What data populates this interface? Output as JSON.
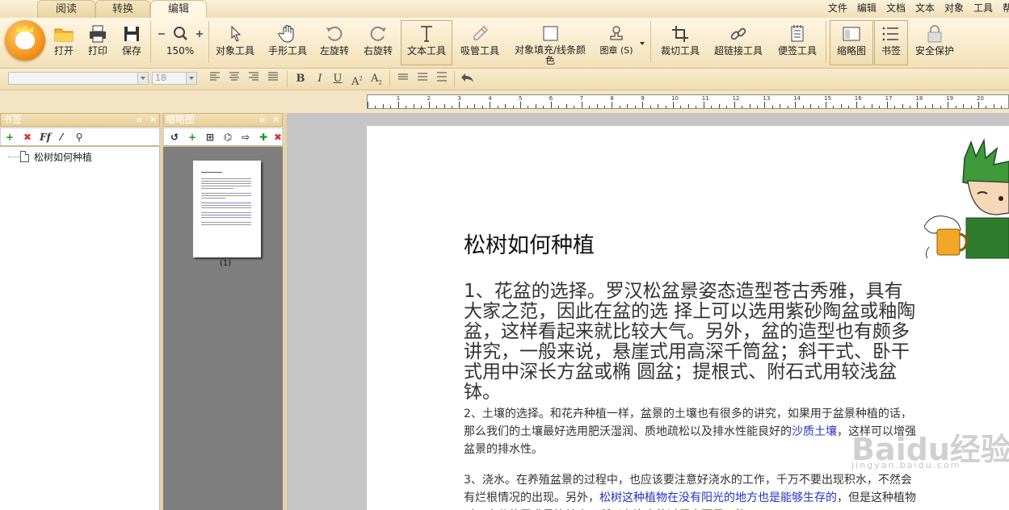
{
  "tabs": [
    {
      "label": "阅读"
    },
    {
      "label": "转换"
    },
    {
      "label": "编辑"
    }
  ],
  "menu": [
    "文件",
    "编辑",
    "文档",
    "文本",
    "对象",
    "工具",
    "帮"
  ],
  "toolbar": {
    "open": "打开",
    "print": "打印",
    "save": "保存",
    "zoom": "150%",
    "object_tool": "对象工具",
    "hand_tool": "手形工具",
    "rotate_left": "左旋转",
    "rotate_right": "右旋转",
    "text_tool": "文本工具",
    "eyedropper": "吸管工具",
    "fill_line": "对象填充/线条颜色",
    "stamp": "图章 (S)",
    "crop": "裁切工具",
    "hyperlink": "超链接工具",
    "sticky_note": "便签工具",
    "thumbnail": "缩略图",
    "bookmark": "书签",
    "security": "安全保护"
  },
  "format": {
    "font_name": "",
    "font_size": "18"
  },
  "ruler_numbers": [
    "1",
    "2",
    "3",
    "4",
    "5",
    "6",
    "7",
    "8",
    "9",
    "10",
    "11",
    "12",
    "13",
    "14",
    "15",
    "16",
    "17",
    "18",
    "19",
    "20"
  ],
  "panels": {
    "bookmarks_title": "书签",
    "thumbnails_title": "缩略图",
    "bookmark_items": [
      "松树如何种植"
    ],
    "thumb_caption": "(1)"
  },
  "document": {
    "title": "松树如何种植",
    "para1": "1、花盆的选择。罗汉松盆景姿态造型苍古秀雅，具有大家之范，因此在盆的选 择上可以选用紫砂陶盆或釉陶盆，这样看起来就比较大气。另外，盆的造型也有颇多讲究，一般来说，悬崖式用高深千筒盆；斜干式、卧干式用中深长方盆或椭 圆盆；提根式、附石式用较浅盆钵。",
    "para2_a": "2、土壤的选择。和花卉种植一样，盆景的土壤也有很多的讲究，如果用于盆景种植的话，那么我们的土壤最好选用肥沃湿润、质地疏松以及排水性能良好的",
    "para2_link": "沙质土壤",
    "para2_b": "，这样可以增强盆景的排水性。",
    "para3_a": "3、浇水。在养殖盆景的过程中，也应该要注意好浇水的工作，千万不要出现积水，不然会有烂根情况的出现。另外，",
    "para3_link": "松树这种植物在没有阳光的地方也是能够生存的",
    "para3_b": "，但是这种植物对于水分的需求量比较大，所以在浇水的过程中要尽可能"
  },
  "watermark": {
    "main": "Baidu经验",
    "sub": "jingyan.baidu.com"
  }
}
